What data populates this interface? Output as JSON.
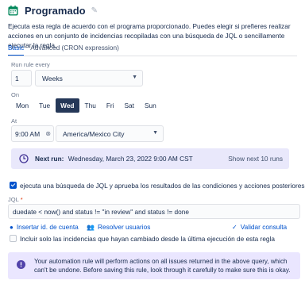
{
  "header": {
    "title": "Programado",
    "icon": "calendar-icon",
    "edit_icon": "pencil-icon"
  },
  "description": "Ejecuta esta regla de acuerdo con el programa proporcionado. Puedes elegir si prefieres realizar acciones en un conjunto de incidencias recopiladas con una búsqueda de JQL o sencillamente ejecutar la regla.",
  "tabs": [
    {
      "label": "Basic",
      "active": true
    },
    {
      "label": "Advanced (CRON expression)",
      "active": false
    }
  ],
  "schedule": {
    "run_every_label": "Run rule every",
    "interval_value": "1",
    "interval_unit": "Weeks",
    "on_label": "On",
    "days": [
      {
        "label": "Mon",
        "selected": false
      },
      {
        "label": "Tue",
        "selected": false
      },
      {
        "label": "Wed",
        "selected": true
      },
      {
        "label": "Thu",
        "selected": false
      },
      {
        "label": "Fri",
        "selected": false
      },
      {
        "label": "Sat",
        "selected": false
      },
      {
        "label": "Sun",
        "selected": false
      }
    ],
    "at_label": "At",
    "time": "9:00 AM",
    "timezone": "America/Mexico City"
  },
  "next_run": {
    "label": "Next run:",
    "value": "Wednesday, March 23, 2022 9:00 AM CST",
    "show_more": "Show next 10 runs"
  },
  "jql_checkbox": {
    "label": "ejecuta una búsqueda de JQL y aprueba los resultados de las condiciones y acciones posteriores",
    "checked": true
  },
  "jql": {
    "label": "JQL",
    "required_mark": "*",
    "value": "duedate < now() and status != \"in review\" and status != done"
  },
  "links": {
    "insert_account": "Insertar id. de cuenta",
    "resolve_users": "Resolver usuarios",
    "validate": "Validar consulta"
  },
  "changed_checkbox": {
    "label": "Incluir solo las incidencias que hayan cambiado desde la última ejecución de esta regla",
    "checked": false
  },
  "warning": {
    "text": "Your automation rule will perform actions on all issues returned in the above query, which can't be undone. Before saving this rule, look through it carefully to make sure this is okay."
  },
  "colors": {
    "accent": "#0052cc",
    "panel": "#e9e8fb",
    "selected_day": "#253858"
  }
}
